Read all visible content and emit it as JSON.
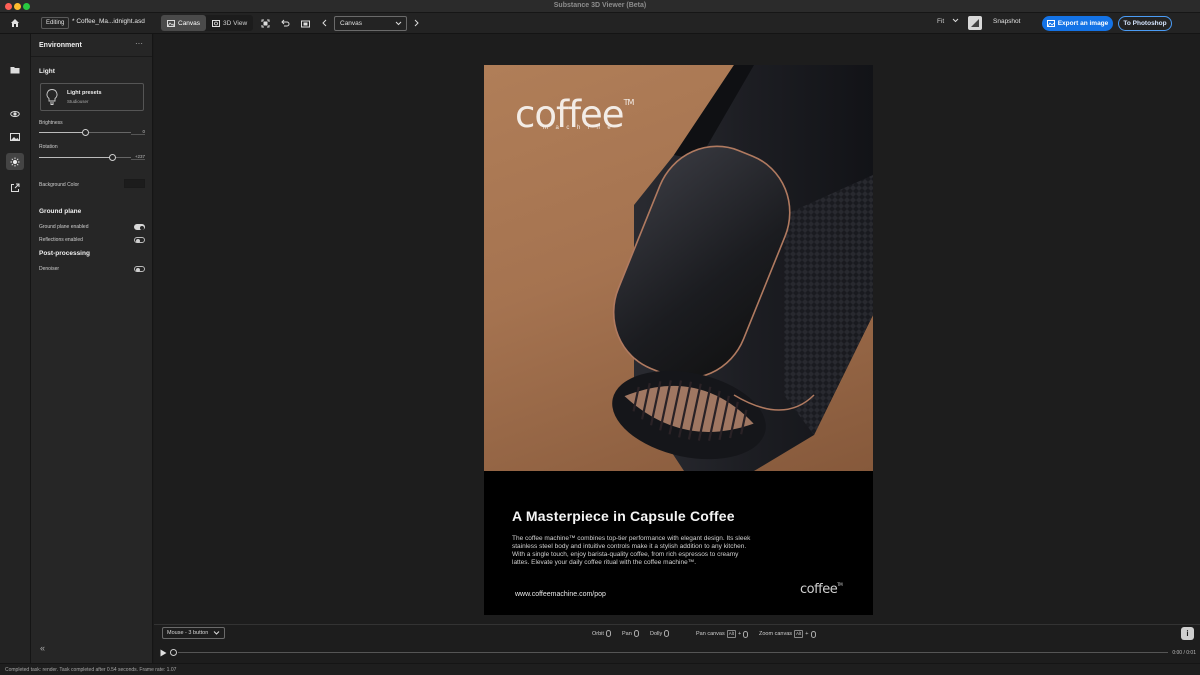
{
  "app": {
    "title": "Substance 3D Viewer (Beta)"
  },
  "toolbar": {
    "mode": "Editing",
    "file_name": "* Coffee_Ma...idnight.asd",
    "view_tabs": [
      {
        "label": "Canvas",
        "active": true
      },
      {
        "label": "3D View",
        "active": false
      }
    ],
    "canvas_select": "Canvas",
    "zoom": "Fit",
    "snapshot_label": "Snapshot",
    "export_label": "Export an image",
    "photoshop_label": "To Photoshop"
  },
  "rail": {
    "icons": [
      "folder-icon",
      "3d-object-icon",
      "image-icon",
      "sun-icon",
      "export-icon"
    ],
    "active": "sun-icon"
  },
  "panel": {
    "title": "Environment",
    "more": "···",
    "light": {
      "section": "Light",
      "preset_title": "Light presets",
      "preset_value": "Studiouser",
      "brightness_label": "Brightness",
      "brightness_value": "0",
      "brightness_pos": 0.5,
      "rotation_label": "Rotation",
      "rotation_value": "+237",
      "rotation_pos": 0.79
    },
    "background_color_label": "Background Color",
    "ground": {
      "section": "Ground plane",
      "enabled_label": "Ground plane enabled",
      "enabled": true,
      "reflections_label": "Reflections enabled",
      "reflections": false
    },
    "post": {
      "section": "Post-processing",
      "denoiser_label": "Denoiser",
      "denoiser": false
    },
    "collapse": "«"
  },
  "poster": {
    "logo": "coffee",
    "logo_tm": "TM",
    "logo_sub": "machine",
    "headline": "A Masterpiece in Capsule Coffee",
    "body": "The coffee machine™ combines top-tier performance with elegant design. Its sleek stainless steel body and intuitive controls make it a stylish addition to any kitchen. With a single touch, enjoy barista-quality coffee, from rich espressos to creamy lattes. Elevate your daily coffee ritual with the coffee machine™.",
    "url": "www.coffeemachine.com/pop",
    "small_logo": "coffee",
    "small_logo_tm": "TM"
  },
  "controls": {
    "mouse_mode": "Mouse - 3 button",
    "orbit": "Orbit",
    "pan": "Pan",
    "dolly": "Dolly",
    "pan_canvas": "Pan canvas",
    "zoom_canvas": "Zoom canvas",
    "alt_key": "Alt",
    "plus": "+",
    "info": "i"
  },
  "timeline": {
    "time": "0:00 / 0:01"
  },
  "status": {
    "text": "Completed task: render. Task completed after 0.54 seconds. Frame rate: 1.07"
  },
  "colors": {
    "accent": "#1473e6",
    "poster_brown": "#a57350",
    "copper": "#c48b6e",
    "device": "#1e1f24"
  }
}
